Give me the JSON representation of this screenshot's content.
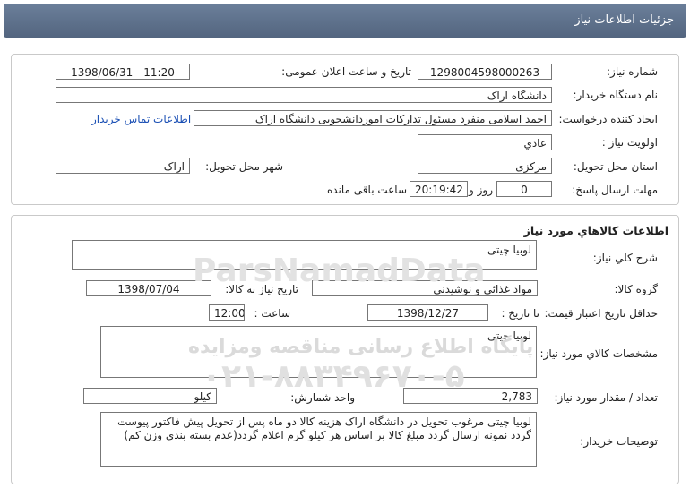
{
  "header": {
    "title": "جزئیات اطلاعات نیاز"
  },
  "need_info": {
    "need_number_label": "شماره نیاز:",
    "need_number": "1298004598000263",
    "announce_label": "تاریخ و ساعت اعلان عمومی:",
    "announce_value": "1398/06/31 - 11:20",
    "buyer_org_label": "نام دستگاه خریدار:",
    "buyer_org": "دانشگاه اراک",
    "creator_label": "ایجاد کننده درخواست:",
    "creator": "احمد  اسلامی منفرد مسئول تدارکات اموردانشجویی دانشگاه اراک",
    "contact_link": "اطلاعات تماس خریدار",
    "priority_label": "اولویت نیاز :",
    "priority": "عادي",
    "province_label": "استان محل تحویل:",
    "province": "مرکزی",
    "city_label": "شهر محل تحویل:",
    "city": "اراک",
    "deadline_label": "مهلت ارسال پاسخ:",
    "days": "0",
    "days_label": "روز و",
    "time_left": "20:19:42",
    "time_left_label": "ساعت باقی مانده"
  },
  "goods": {
    "section_title": "اطلاعات کالاهاي مورد نياز",
    "summary_label": "شرح کلي نياز:",
    "summary": "لوبیا چیتی",
    "group_label": "گروه کالا:",
    "group": "مواد غذائی و نوشیدنی",
    "need_date_label": "تاریخ نیاز به کالا:",
    "need_date": "1398/07/04",
    "validity_label": "حداقل تاریخ اعتبار قیمت:",
    "until_label": "تا تاریخ :",
    "validity_date": "1398/12/27",
    "hour_label": "ساعت :",
    "validity_time": "12:00",
    "specs_label": "مشخصات کالاي مورد نياز:",
    "specs": "لوبیا چیتی",
    "qty_label": "تعداد / مقدار مورد نیاز:",
    "qty": "2,783",
    "unit_label": "واحد شمارش:",
    "unit": "کیلو",
    "buyer_notes_label": "توضیحات خریدار:",
    "buyer_notes": "لوبیا چیتی مرغوب تحویل در دانشگاه اراک هزینه کالا دو ماه پس از تحویل پیش فاکتور پیوست گردد نمونه ارسال گردد مبلغ کالا بر اساس هر کیلو گرم اعلام گردد(عدم بسته بندی وزن کم)"
  },
  "watermark": {
    "brand": "ParsNamadData",
    "line1": "پایگاه اطلاع رسانی مناقصه ومزایده",
    "phone": "۰۲۱-۸۸۳۴۹۶۷۰-۵"
  }
}
